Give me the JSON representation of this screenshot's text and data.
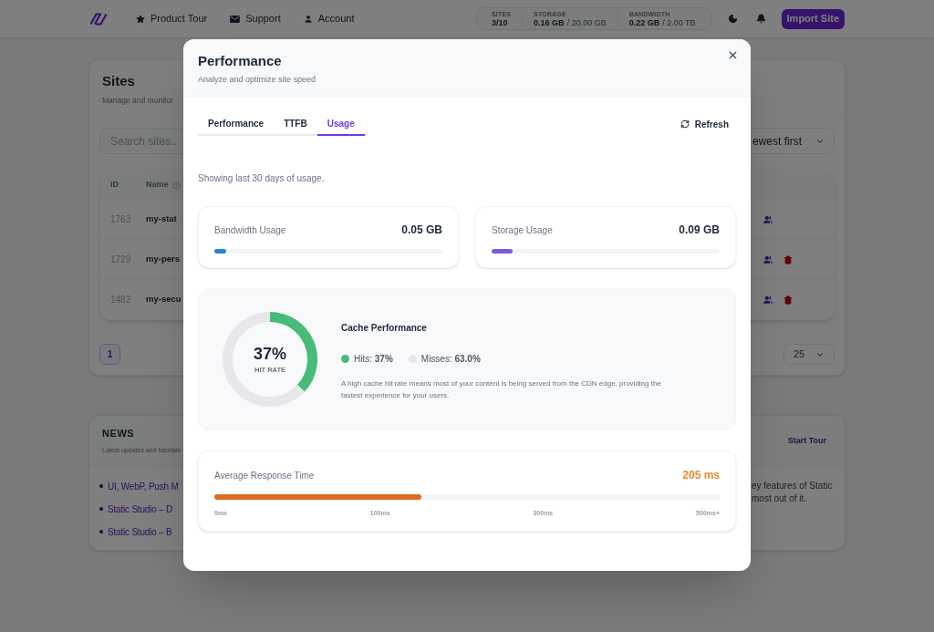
{
  "nav": {
    "links": [
      "Product Tour",
      "Support",
      "Account"
    ],
    "stats": [
      {
        "label": "SITES",
        "value": "3/10"
      },
      {
        "label": "STORAGE",
        "value": "0.16 GB",
        "limit": "/ 20.00 GB"
      },
      {
        "label": "BANDWIDTH",
        "value": "0.22 GB",
        "limit": "/ 2.00 TB"
      }
    ],
    "import_button": "Import Site"
  },
  "sites": {
    "title": "Sites",
    "subtitle": "Manage and monitor",
    "search": {
      "placeholder": "Search sites.."
    },
    "sort": {
      "value": "ewest first"
    },
    "table": {
      "columns": [
        "ID",
        "Name"
      ],
      "rows": [
        {
          "id": "1763",
          "name": "my-stat",
          "deletable": false
        },
        {
          "id": "1729",
          "name": "my-pers",
          "deletable": true
        },
        {
          "id": "1482",
          "name": "my-secu",
          "deletable": true
        }
      ]
    },
    "pagination": {
      "pages": [
        {
          "label": "1",
          "selected": true
        }
      ],
      "per_page": "25"
    }
  },
  "news": {
    "title": "NEWS",
    "subtitle": "Latest updates and tutorials",
    "action": "Start Tour",
    "links": [
      "UI, WebP, Push M",
      "Static Studio – D",
      "Static Studio – B"
    ],
    "description_lines": [
      "ey features of Static",
      "most out of it."
    ]
  },
  "modal": {
    "title": "Performance",
    "subtitle": "Analyze and optimize site speed",
    "tabs": [
      {
        "label": "Performance",
        "selected": false
      },
      {
        "label": "TTFB",
        "selected": false
      },
      {
        "label": "Usage",
        "selected": true
      }
    ],
    "refresh": "Refresh",
    "note": "Showing last 30 days of usage.",
    "usage": [
      {
        "label": "Bandwidth Usage",
        "value": "0.05 GB",
        "level": 0.05,
        "color": "#3182ce"
      },
      {
        "label": "Storage Usage",
        "value": "0.09 GB",
        "level": 0.09,
        "color": "#805ad5"
      }
    ],
    "cache": {
      "title": "Cache Performance",
      "chart_data": {
        "type": "donut",
        "values": [
          37,
          63
        ]
      },
      "rate": "37%",
      "rate_label": "HIT RATE",
      "legend": [
        {
          "text": "Hits: **37%**",
          "color": "#48bb78"
        },
        {
          "text": "Misses: **63.0%**",
          "color": "#e5e7eb"
        }
      ],
      "description": "A high cache hit rate means most of your content is being served from the CDN edge, providing the fastest experience for your users."
    },
    "response": {
      "label": "Average Response Time",
      "value": "205 ms",
      "level": 0.41,
      "ticks": [
        "0ms",
        "100ms",
        "300ms",
        "500ms+"
      ]
    }
  }
}
